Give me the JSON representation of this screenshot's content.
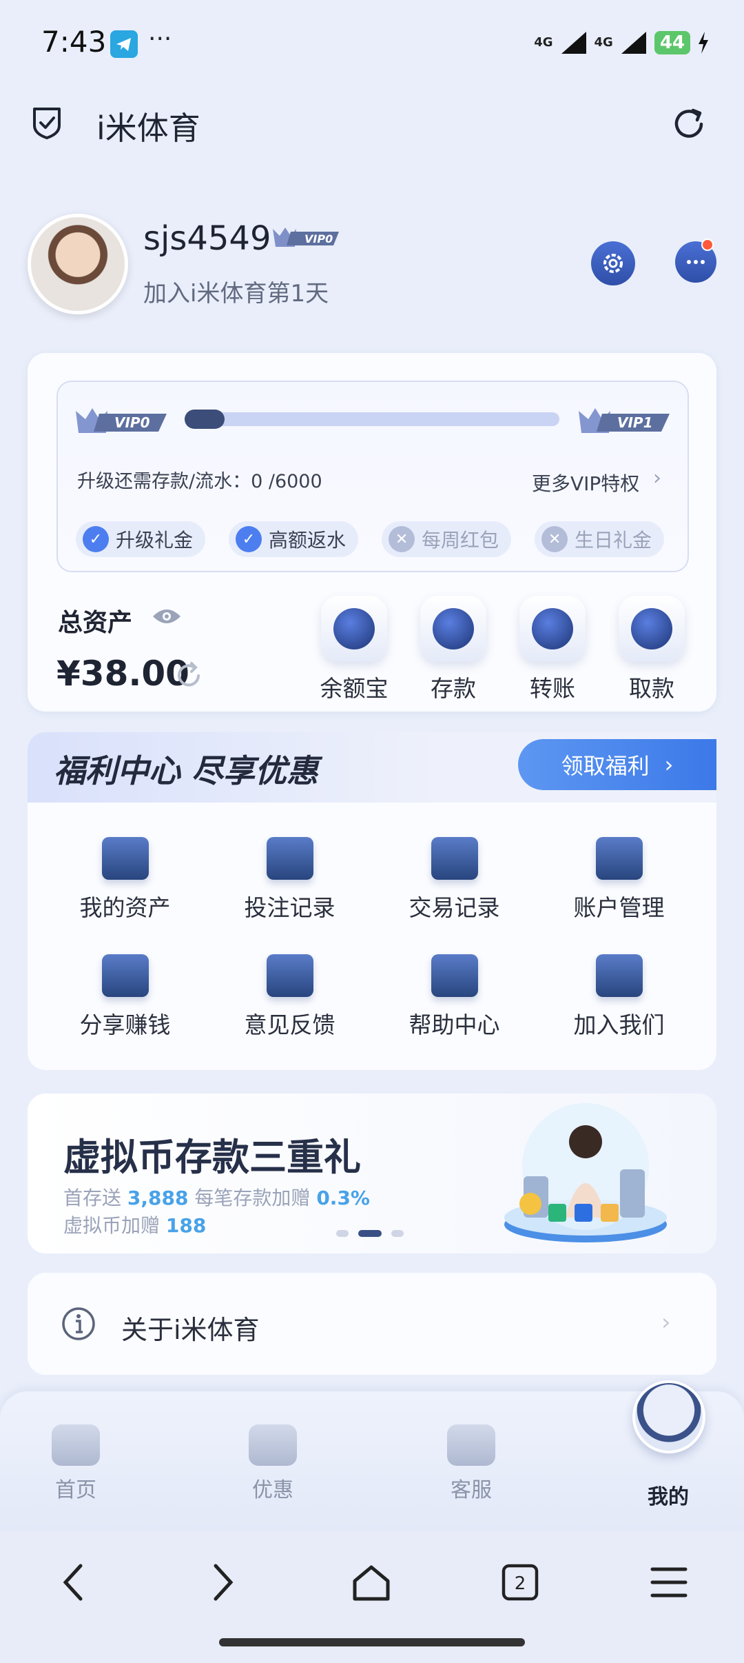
{
  "status_bar": {
    "time": "7:43",
    "more": "···",
    "network_1": "4G",
    "network_2": "4G",
    "battery": "44"
  },
  "header": {
    "title": "i米体育"
  },
  "profile": {
    "username": "sjs4549",
    "vip_badge": "VIP0",
    "join_text": "加入i米体育第1天"
  },
  "vip": {
    "current_level": "VIP0",
    "next_level": "VIP1",
    "progress": 0,
    "upgrade_text": "升级还需存款/流水：0 /6000",
    "more_label": "更多VIP特权",
    "perks": [
      {
        "label": "升级礼金",
        "enabled": true
      },
      {
        "label": "高额返水",
        "enabled": true
      },
      {
        "label": "每周红包",
        "enabled": false
      },
      {
        "label": "生日礼金",
        "enabled": false
      }
    ]
  },
  "assets": {
    "label": "总资产",
    "value": "¥38.00",
    "actions": [
      {
        "label": "余额宝",
        "icon": "database-icon"
      },
      {
        "label": "存款",
        "icon": "wallet-icon"
      },
      {
        "label": "转账",
        "icon": "transfer-icon"
      },
      {
        "label": "取款",
        "icon": "card-icon"
      }
    ]
  },
  "welfare": {
    "title": "福利中心 尽享优惠",
    "button": "领取福利",
    "items": [
      {
        "label": "我的资产",
        "icon": "wallet-icon"
      },
      {
        "label": "投注记录",
        "icon": "ledger-icon"
      },
      {
        "label": "交易记录",
        "icon": "clipboard-icon"
      },
      {
        "label": "账户管理",
        "icon": "folder-icon"
      },
      {
        "label": "分享赚钱",
        "icon": "handshake-icon"
      },
      {
        "label": "意见反馈",
        "icon": "edit-icon"
      },
      {
        "label": "帮助中心",
        "icon": "help-book-icon"
      },
      {
        "label": "加入我们",
        "icon": "people-icon"
      }
    ]
  },
  "banner": {
    "title": "虚拟币存款三重礼",
    "line1_prefix": "首存送",
    "line1_value": "3,888",
    "line1_mid": "每笔存款加赠",
    "line1_rate": "0.3%",
    "line2_prefix": "虚拟币加赠",
    "line2_value": "188",
    "active_slide": 2,
    "slide_count": 3
  },
  "about": {
    "label": "关于i米体育"
  },
  "tabbar": [
    {
      "label": "首页",
      "icon": "home-icon",
      "active": false
    },
    {
      "label": "优惠",
      "icon": "discount-icon",
      "active": false
    },
    {
      "label": "客服",
      "icon": "headset-icon",
      "active": false
    },
    {
      "label": "我的",
      "icon": "user-icon",
      "active": true
    }
  ],
  "system_nav": {
    "tabs_count": "2"
  },
  "colors": {
    "accent": "#4c7ef0",
    "brand_dark": "#2f4fa8",
    "notification": "#ff5a3c",
    "highlight": "#48a2e8"
  }
}
